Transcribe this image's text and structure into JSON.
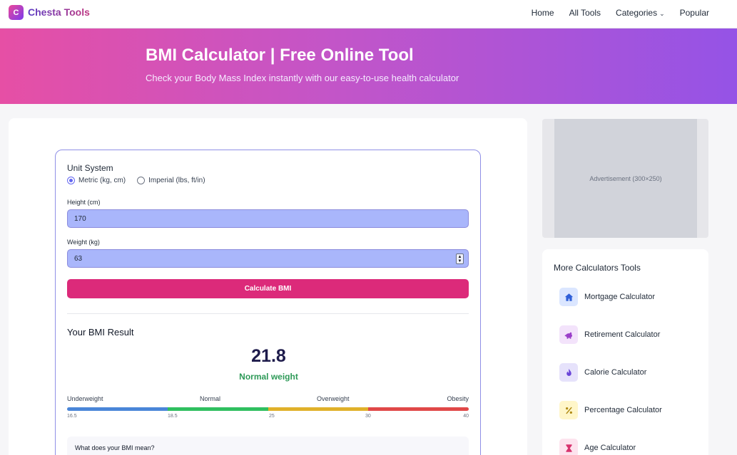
{
  "brand": {
    "logo_letter": "C",
    "name": "Chesta Tools"
  },
  "nav": [
    {
      "label": "Home"
    },
    {
      "label": "All Tools"
    },
    {
      "label": "Categories"
    },
    {
      "label": "Popular"
    }
  ],
  "hero": {
    "title": "BMI Calculator | Free Online Tool",
    "subtitle": "Check your Body Mass Index instantly with our easy-to-use health calculator"
  },
  "form": {
    "unit_label": "Unit System",
    "units": [
      {
        "label": "Metric (kg, cm)",
        "selected": true
      },
      {
        "label": "Imperial (lbs, ft/in)",
        "selected": false
      }
    ],
    "height_label": "Height (cm)",
    "height_value": "170",
    "weight_label": "Weight (kg)",
    "weight_value": "63",
    "calculate_label": "Calculate BMI"
  },
  "result": {
    "title": "Your BMI Result",
    "value": "21.8",
    "category": "Normal weight",
    "category_color": "#2e9a58",
    "scale_labels": [
      "Underweight",
      "Normal",
      "Overweight",
      "Obesity"
    ],
    "scale_colors": [
      "#4a86d8",
      "#2fbf5f",
      "#e0b12a",
      "#e04848"
    ],
    "ticks": [
      "16.5",
      "18.5",
      "25",
      "30",
      "40"
    ],
    "meaning_title": "What does your BMI mean?"
  },
  "ad": {
    "label": "Advertisement (300×250)"
  },
  "more_tools": {
    "title": "More Calculators Tools",
    "items": [
      {
        "label": "Mortgage Calculator",
        "icon": "home-icon",
        "bg": "#dbe6ff",
        "fg": "#2f5fd8"
      },
      {
        "label": "Retirement Calculator",
        "icon": "piggy-bank-icon",
        "bg": "#f3e3fb",
        "fg": "#9b3fc9"
      },
      {
        "label": "Calorie Calculator",
        "icon": "fire-icon",
        "bg": "#e6e2fb",
        "fg": "#6a45d8"
      },
      {
        "label": "Percentage Calculator",
        "icon": "percent-icon",
        "bg": "#fff6c9",
        "fg": "#b08a14"
      },
      {
        "label": "Age Calculator",
        "icon": "hourglass-icon",
        "bg": "#fde3ee",
        "fg": "#d8336e"
      }
    ]
  }
}
